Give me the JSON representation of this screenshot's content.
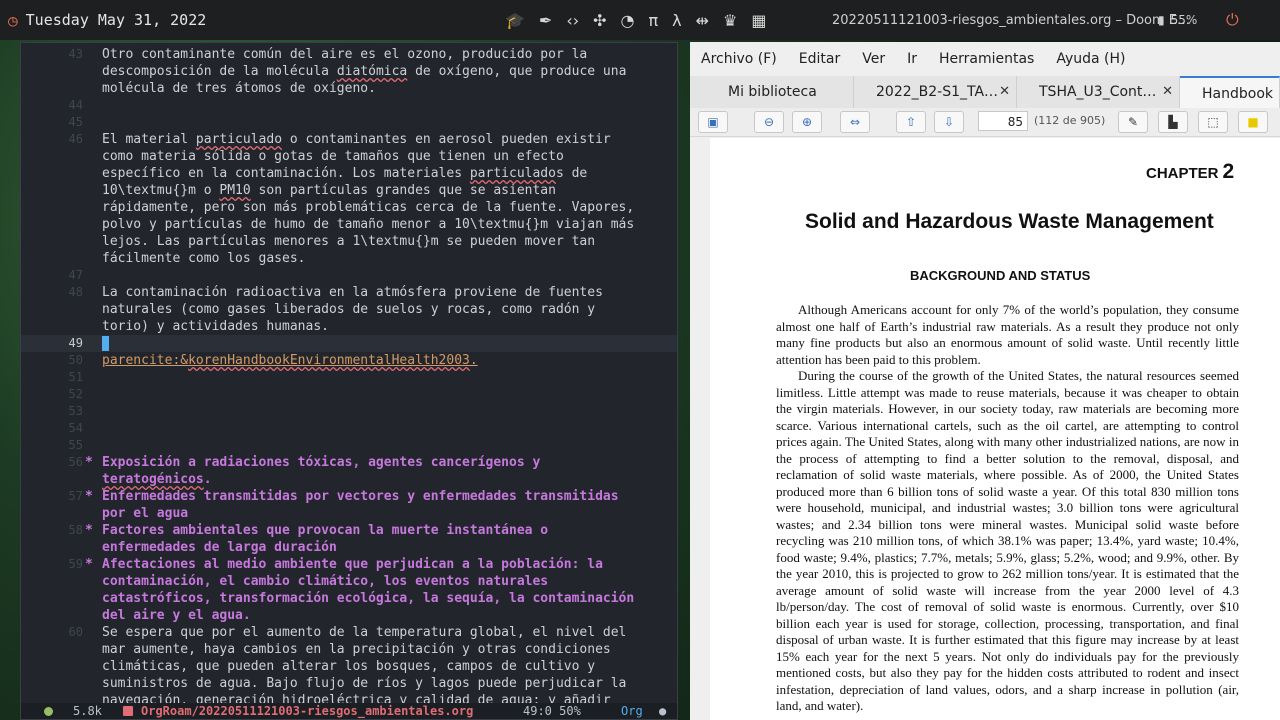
{
  "topbar": {
    "date": "Tuesday May 31, 2022",
    "window_title": "20220511121003-riesgos_ambientales.org – Doom E…",
    "battery": "55%",
    "tray_icons": [
      "graduation-cap-icon",
      "pen-icon",
      "code-icon",
      "puzzle-icon",
      "palette-icon",
      "pi-icon",
      "lambda-icon",
      "split-icon",
      "crown-icon",
      "grid-icon"
    ]
  },
  "emacs": {
    "lines": [
      {
        "n": "43",
        "text": "Otro contaminante común del aire es el ozono, producido por la"
      },
      {
        "n": "",
        "text": "descomposición de la molécula diatómica de oxígeno, que produce una"
      },
      {
        "n": "",
        "text": "molécula de tres átomos de oxígeno."
      },
      {
        "n": "44",
        "text": ""
      },
      {
        "n": "45",
        "text": ""
      },
      {
        "n": "46",
        "text": "El material particulado o contaminantes en aerosol pueden existir"
      },
      {
        "n": "",
        "text": "como materia sólida o gotas de tamaños que tienen un efecto"
      },
      {
        "n": "",
        "text": "específico en la contaminación. Los materiales particulados de"
      },
      {
        "n": "",
        "text": "10\\textmu{}m o PM10 son partículas grandes que se asientan"
      },
      {
        "n": "",
        "text": "rápidamente, pero son más problemáticas cerca de la fuente. Vapores,"
      },
      {
        "n": "",
        "text": "polvo y partículas de humo de tamaño menor a 10\\textmu{}m viajan más"
      },
      {
        "n": "",
        "text": "lejos. Las partículas menores a 1\\textmu{}m se pueden mover tan"
      },
      {
        "n": "",
        "text": "fácilmente como los gases."
      },
      {
        "n": "47",
        "text": ""
      },
      {
        "n": "48",
        "text": "La contaminación radioactiva en la atmósfera proviene de fuentes"
      },
      {
        "n": "",
        "text": "naturales (como gases liberados de suelos y rocas, como radón y"
      },
      {
        "n": "",
        "text": "torio) y actividades humanas."
      },
      {
        "n": "49",
        "text": "",
        "current": true
      },
      {
        "n": "50",
        "text": "parencite:&korenHandbookEnvironmentalHealth2003.",
        "link": true
      },
      {
        "n": "51",
        "text": ""
      },
      {
        "n": "52",
        "text": ""
      },
      {
        "n": "53",
        "text": ""
      },
      {
        "n": "54",
        "text": ""
      },
      {
        "n": "55",
        "text": ""
      },
      {
        "n": "56",
        "text": "Exposición a radiaciones tóxicas, agentes cancerígenos y",
        "heading": true,
        "bullet": "*"
      },
      {
        "n": "",
        "text": "teratogénicos.",
        "heading": true
      },
      {
        "n": "57",
        "text": "Enfermedades transmitidas por vectores y enfermedades transmitidas",
        "heading": true,
        "bullet": "*"
      },
      {
        "n": "",
        "text": "por el agua",
        "heading": true
      },
      {
        "n": "58",
        "text": "Factores ambientales que provocan la muerte instantánea o",
        "heading": true,
        "bullet": "*"
      },
      {
        "n": "",
        "text": "enfermedades de larga duración",
        "heading": true
      },
      {
        "n": "59",
        "text": "Afectaciones al medio ambiente que perjudican a la población: la",
        "heading": true,
        "bullet": "*"
      },
      {
        "n": "",
        "text": "contaminación, el cambio climático, los eventos naturales",
        "heading": true
      },
      {
        "n": "",
        "text": "catastróficos, transformación ecológica, la sequía, la contaminación",
        "heading": true
      },
      {
        "n": "",
        "text": "del aire y el agua.",
        "heading": true
      },
      {
        "n": "60",
        "text": "Se espera que por el aumento de la temperatura global, el nivel del"
      },
      {
        "n": "",
        "text": "mar aumente, haya cambios en la precipitación y otras condiciones"
      },
      {
        "n": "",
        "text": "climáticas, que pueden alterar los bosques, campos de cultivo y"
      },
      {
        "n": "",
        "text": "suministros de agua. Bajo flujo de ríos y lagos puede perjudicar la"
      },
      {
        "n": "",
        "text": "navegación, generación hidroeléctrica y calidad de agua; y añadir"
      }
    ],
    "modeline": {
      "size": "5.8k",
      "file": "OrgRoam/20220511121003-riesgos_ambientales.org",
      "position": "49:0 50%",
      "mode": "Org"
    }
  },
  "zotero": {
    "menu": [
      "Archivo (F)",
      "Editar",
      "Ver",
      "Ir",
      "Herramientas",
      "Ayuda (H)"
    ],
    "tabs": [
      {
        "label": "Mi biblioteca",
        "closable": false
      },
      {
        "label": "2022_B2-S1_TA…",
        "closable": true
      },
      {
        "label": "TSHA_U3_Cont…",
        "closable": true
      },
      {
        "label": "Handbook",
        "closable": false,
        "active": true
      }
    ],
    "page_number": "85",
    "page_of": "(112 de 905)",
    "pdf": {
      "chapter_label": "CHAPTER",
      "chapter_number": "2",
      "title": "Solid and Hazardous Waste Management",
      "section": "BACKGROUND AND STATUS",
      "paragraphs": [
        "Although Americans account for only 7% of the world’s population, they consume almost one half of Earth’s industrial raw materials. As a result they produce not only many fine products but also an enormous amount of solid waste. Until recently little attention has been paid to this problem.",
        "During the course of the growth of the United States, the natural resources seemed limitless. Little attempt was made to reuse materials, because it was cheaper to obtain the virgin materials. However, in our society today, raw materials are becoming more scarce. Various international cartels, such as the oil cartel, are attempting to control prices again. The United States, along with many other industrialized nations, are now in the process of attempting to find a better solution to the removal, disposal, and reclamation of solid waste materials, where possible. As of 2000, the United States produced more than 6 billion tons of solid waste a year. Of this total 830 million tons were household, municipal, and industrial wastes; 3.0 billion tons were agricultural wastes; and 2.34 billion tons were mineral wastes. Municipal solid waste before recycling was 210 million tons, of which 38.1% was paper; 13.4%, yard waste; 10.4%, food waste; 9.4%, plastics; 7.7%, metals; 5.9%, glass; 5.2%, wood; and 9.9%, other. By the year 2010, this is projected to grow to 262 million tons/year. It is estimated that the average amount of solid waste will increase from the year 2000 level of 4.3 lb/person/day. The cost of removal of solid waste is enormous. Currently, over $10 billion each year is used for storage, collection, processing, transportation, and final disposal of urban waste. It is further estimated that this figure may increase by at least 15% each year for the next 5 years. Not only do individuals pay for the previously mentioned costs, but also they pay for the hidden costs attributed to rodent and insect infestation, depreciation of land values, odors, and a sharp increase in pollution (air, land, and water)."
      ]
    }
  }
}
